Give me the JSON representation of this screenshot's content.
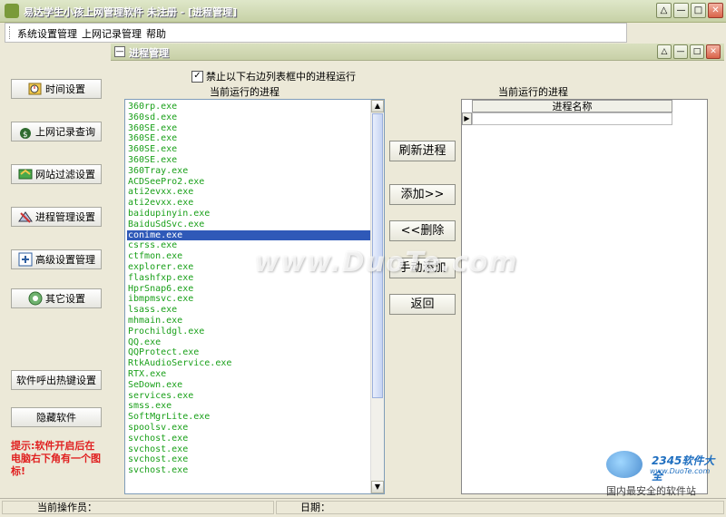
{
  "window": {
    "title": "易达学生小孩上网管理软件 未注册 - [进程管理]",
    "controls": [
      "△",
      "—",
      "□",
      "✕"
    ]
  },
  "menu": [
    "系统设置管理",
    "上网记录管理",
    "帮助"
  ],
  "sidebar": {
    "buttons": [
      {
        "label": "时间设置",
        "icon": "clock-icon"
      },
      {
        "label": "上网记录查询",
        "icon": "money-bag-icon"
      },
      {
        "label": "网站过滤设置",
        "icon": "filter-icon"
      },
      {
        "label": "进程管理设置",
        "icon": "process-icon"
      },
      {
        "label": "高级设置管理",
        "icon": "advanced-icon"
      },
      {
        "label": "其它设置",
        "icon": "settings-icon"
      }
    ],
    "hotkey_button": "软件呼出热键设置",
    "hide_button": "隐藏软件",
    "tip": "提示:软件开启后在电脑右下角有一个图标!"
  },
  "inner_window": {
    "title": "进程管理",
    "controls": [
      "△",
      "—",
      "□",
      "✕"
    ]
  },
  "process_manager": {
    "checkbox_label": "禁止以下右边列表框中的进程运行",
    "checkbox_checked": true,
    "left_label": "当前运行的进程",
    "right_label": "当前运行的进程",
    "processes": [
      "360rp.exe",
      "360sd.exe",
      "360SE.exe",
      "360SE.exe",
      "360SE.exe",
      "360SE.exe",
      "360Tray.exe",
      "ACDSeePro2.exe",
      "ati2evxx.exe",
      "ati2evxx.exe",
      "baidupinyin.exe",
      "BaiduSdSvc.exe",
      "conime.exe",
      "csrss.exe",
      "ctfmon.exe",
      "explorer.exe",
      "flashfxp.exe",
      "HprSnap6.exe",
      "ibmpmsvc.exe",
      "lsass.exe",
      "mhmain.exe",
      "Prochildgl.exe",
      "QQ.exe",
      "QQProtect.exe",
      "RtkAudioService.exe",
      "RTX.exe",
      "SeDown.exe",
      "services.exe",
      "smss.exe",
      "SoftMgrLite.exe",
      "spoolsv.exe",
      "svchost.exe",
      "svchost.exe",
      "svchost.exe",
      "svchost.exe"
    ],
    "selected_index": 12,
    "buttons": [
      "刷新进程",
      "添加>>",
      "<<删除",
      "手动添加",
      "返回"
    ],
    "grid_header": "进程名称"
  },
  "status": {
    "operator_label": "当前操作员：",
    "date_label": "日期："
  },
  "watermark": "www.DuoTe.com",
  "corner_logo": {
    "brand": "2345软件大全",
    "url": "www.DuoTe.com",
    "slogan": "国内最安全的软件站"
  },
  "colors": {
    "process_text": "#1aa01a",
    "selection": "#2f59b8",
    "tip_text": "#e02020"
  }
}
